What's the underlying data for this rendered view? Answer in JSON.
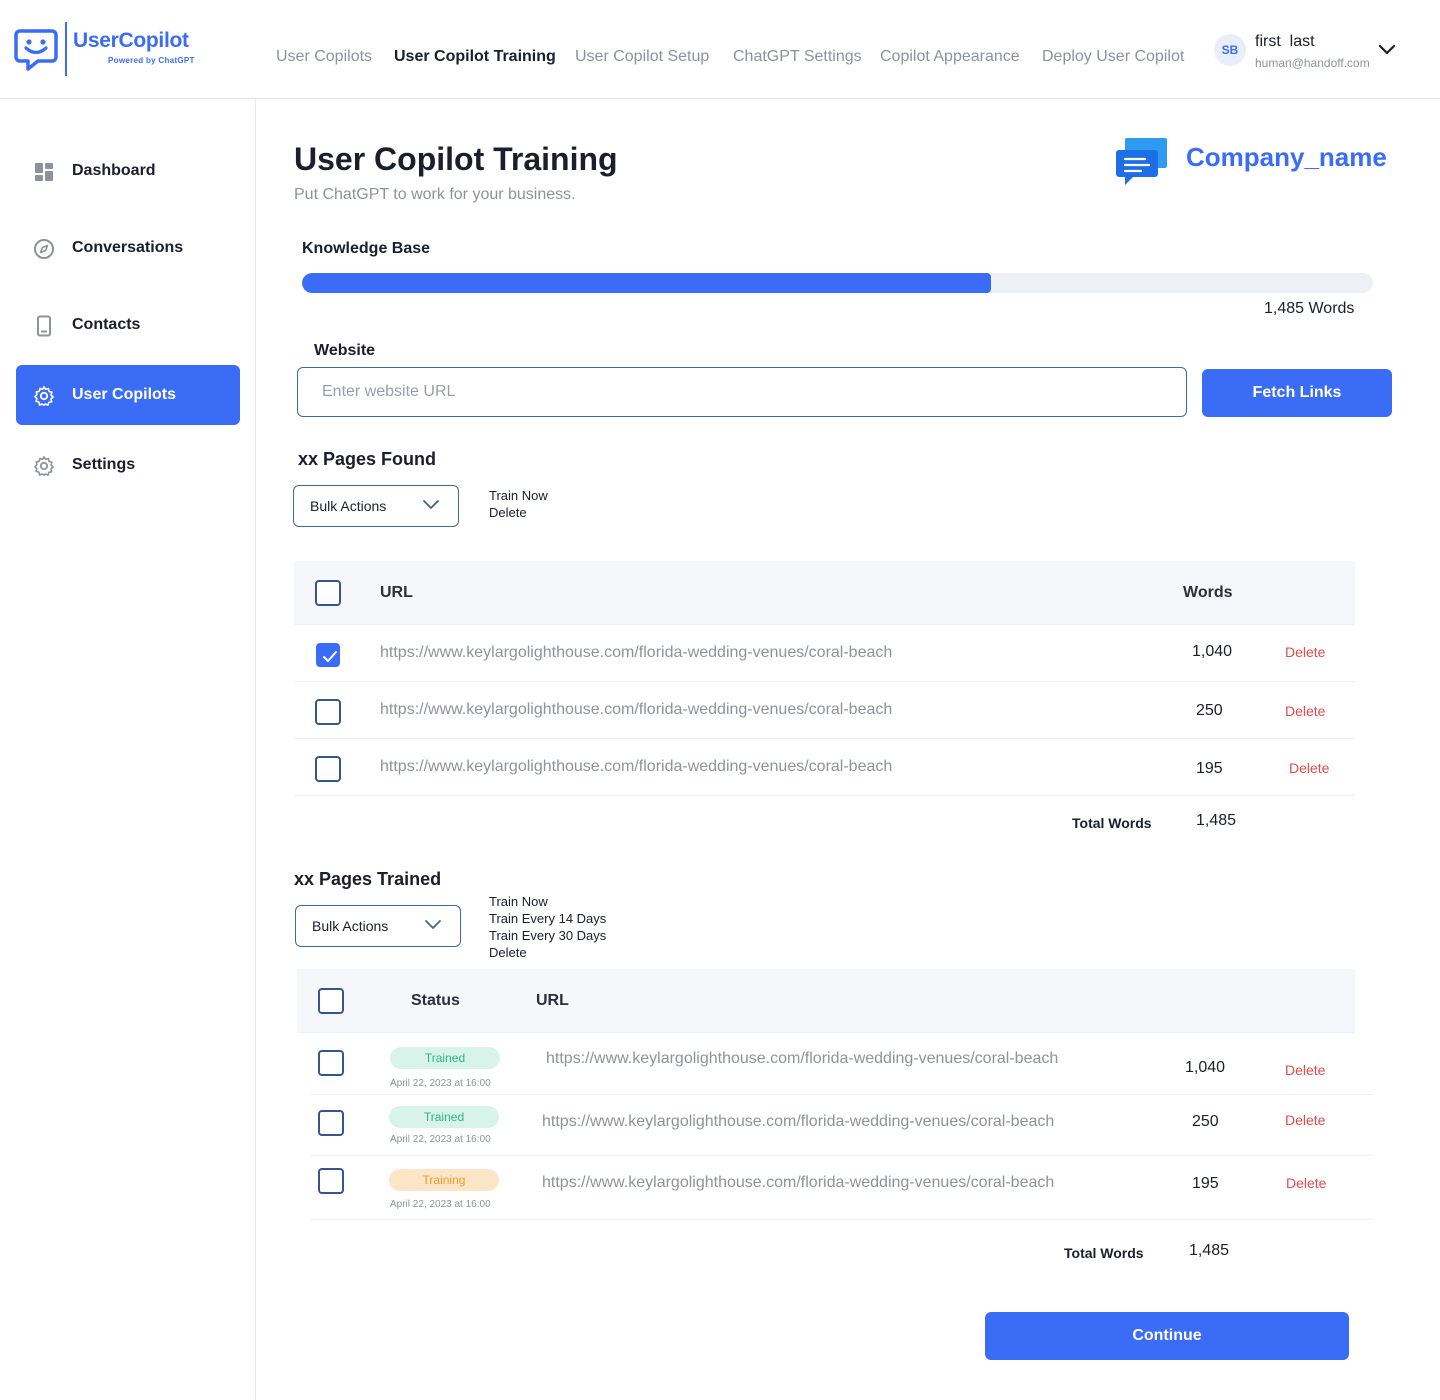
{
  "brand": {
    "name": "UserCopilot",
    "tagline": "Powered by ChatGPT"
  },
  "nav": [
    {
      "label": "User Copilots",
      "active": false
    },
    {
      "label": "User Copilot Training",
      "active": true
    },
    {
      "label": "User Copilot Setup",
      "active": false
    },
    {
      "label": "ChatGPT Settings",
      "active": false
    },
    {
      "label": "Copilot Appearance",
      "active": false
    },
    {
      "label": "Deploy User Copilot",
      "active": false
    }
  ],
  "user": {
    "initials": "SB",
    "name": "first  last",
    "email": "human@handoff.com"
  },
  "sidebar": {
    "items": [
      {
        "label": "Dashboard",
        "icon": "dashboard-icon",
        "active": false
      },
      {
        "label": "Conversations",
        "icon": "compass-icon",
        "active": false
      },
      {
        "label": "Contacts",
        "icon": "phone-icon",
        "active": false
      },
      {
        "label": "User Copilots",
        "icon": "gear-icon",
        "active": true
      },
      {
        "label": "Settings",
        "icon": "gear-icon",
        "active": false
      }
    ]
  },
  "page": {
    "title": "User Copilot Training",
    "subtitle": "Put ChatGPT to work for your business.",
    "company_name": "Company_name"
  },
  "knowledge_base": {
    "label": "Knowledge Base",
    "progress_fraction": 0.643,
    "words_label": "1,485 Words"
  },
  "website": {
    "label": "Website",
    "placeholder": "Enter website URL",
    "value": "",
    "button": "Fetch Links"
  },
  "pages_found": {
    "title": "xx Pages Found",
    "bulk_label": "Bulk Actions",
    "bulk_options": [
      "Train Now",
      "Delete"
    ],
    "columns": {
      "url": "URL",
      "words": "Words"
    },
    "rows": [
      {
        "checked": true,
        "url": "https://www.keylargolighthouse.com/florida-wedding-venues/coral-beach",
        "words": "1,040",
        "action": "Delete"
      },
      {
        "checked": false,
        "url": "https://www.keylargolighthouse.com/florida-wedding-venues/coral-beach",
        "words": "250",
        "action": "Delete"
      },
      {
        "checked": false,
        "url": "https://www.keylargolighthouse.com/florida-wedding-venues/coral-beach",
        "words": "195",
        "action": "Delete"
      }
    ],
    "total_label": "Total Words",
    "total_value": "1,485"
  },
  "pages_trained": {
    "title": "xx Pages Trained",
    "bulk_label": "Bulk Actions",
    "bulk_options": [
      "Train Now",
      "Train Every 14 Days",
      "Train Every 30 Days",
      "Delete"
    ],
    "columns": {
      "status": "Status",
      "url": "URL"
    },
    "rows": [
      {
        "checked": false,
        "status": "Trained",
        "timestamp": "April 22, 2023 at 16:00",
        "url": "https://www.keylargolighthouse.com/florida-wedding-venues/coral-beach",
        "words": "1,040",
        "action": "Delete"
      },
      {
        "checked": false,
        "status": "Trained",
        "timestamp": "April 22, 2023 at 16:00",
        "url": "https://www.keylargolighthouse.com/florida-wedding-venues/coral-beach",
        "words": "250",
        "action": "Delete"
      },
      {
        "checked": false,
        "status": "Training",
        "timestamp": "April 22, 2023 at 16:00",
        "url": "https://www.keylargolighthouse.com/florida-wedding-venues/coral-beach",
        "words": "195",
        "action": "Delete"
      }
    ],
    "total_label": "Total Words",
    "total_value": "1,485"
  },
  "continue_button": "Continue",
  "colors": {
    "accent": "#3b6cf6",
    "danger": "#e14b4b",
    "trained_bg": "#d8f3ea",
    "trained_fg": "#2fb383",
    "training_bg": "#fde6c8",
    "training_fg": "#f09a2a"
  }
}
